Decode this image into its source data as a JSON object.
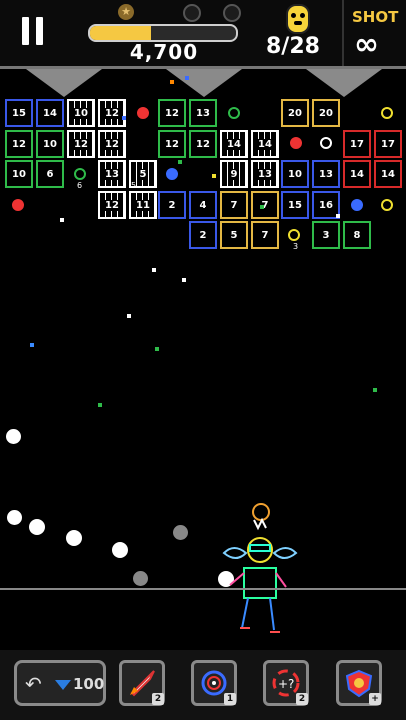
{
  "hud": {
    "score": "4,700",
    "progress": 0.42,
    "counter": "8/28",
    "shot_label": "SHOT",
    "shot_value": "∞"
  },
  "blocks": [
    {
      "c": "blue",
      "v": "15"
    },
    {
      "c": "blue",
      "v": "14"
    },
    {
      "c": "white",
      "v": "10"
    },
    {
      "c": "white",
      "v": "12"
    },
    {
      "c": "green",
      "v": "12"
    },
    {
      "c": "green",
      "v": "13"
    },
    {
      "c": "yellow",
      "v": "20"
    },
    {
      "c": "yellow",
      "v": "20"
    },
    {
      "c": "green",
      "v": "12"
    },
    {
      "c": "green",
      "v": "10"
    },
    {
      "c": "white",
      "v": "12"
    },
    {
      "c": "white",
      "v": "12"
    },
    {
      "c": "green",
      "v": "12"
    },
    {
      "c": "green",
      "v": "12"
    },
    {
      "c": "white",
      "v": "14"
    },
    {
      "c": "white",
      "v": "14"
    },
    {
      "c": "red",
      "v": "17"
    },
    {
      "c": "red",
      "v": "17"
    },
    {
      "c": "green",
      "v": "10"
    },
    {
      "c": "green",
      "v": "6"
    },
    {
      "c": "white",
      "v": "13"
    },
    {
      "c": "white",
      "v": "5"
    },
    {
      "c": "white",
      "v": "9"
    },
    {
      "c": "white",
      "v": "13"
    },
    {
      "c": "blue",
      "v": "10"
    },
    {
      "c": "blue",
      "v": "13"
    },
    {
      "c": "red",
      "v": "14"
    },
    {
      "c": "red",
      "v": "14"
    },
    {
      "c": "white",
      "v": "12"
    },
    {
      "c": "white",
      "v": "11"
    },
    {
      "c": "blue",
      "v": "2"
    },
    {
      "c": "blue",
      "v": "4"
    },
    {
      "c": "yellow",
      "v": "7"
    },
    {
      "c": "yellow",
      "v": "7"
    },
    {
      "c": "blue",
      "v": "15"
    },
    {
      "c": "blue",
      "v": "16"
    },
    {
      "c": "blue",
      "v": "2"
    },
    {
      "c": "yellow",
      "v": "5"
    },
    {
      "c": "yellow",
      "v": "7"
    },
    {
      "c": "green",
      "v": "3"
    },
    {
      "c": "green",
      "v": "8"
    }
  ],
  "powerup_counts": [
    "6",
    "5",
    "3"
  ],
  "bottom": {
    "undo_cost": "100",
    "rocket_count": "2",
    "target_count": "1",
    "random_count": "2"
  }
}
